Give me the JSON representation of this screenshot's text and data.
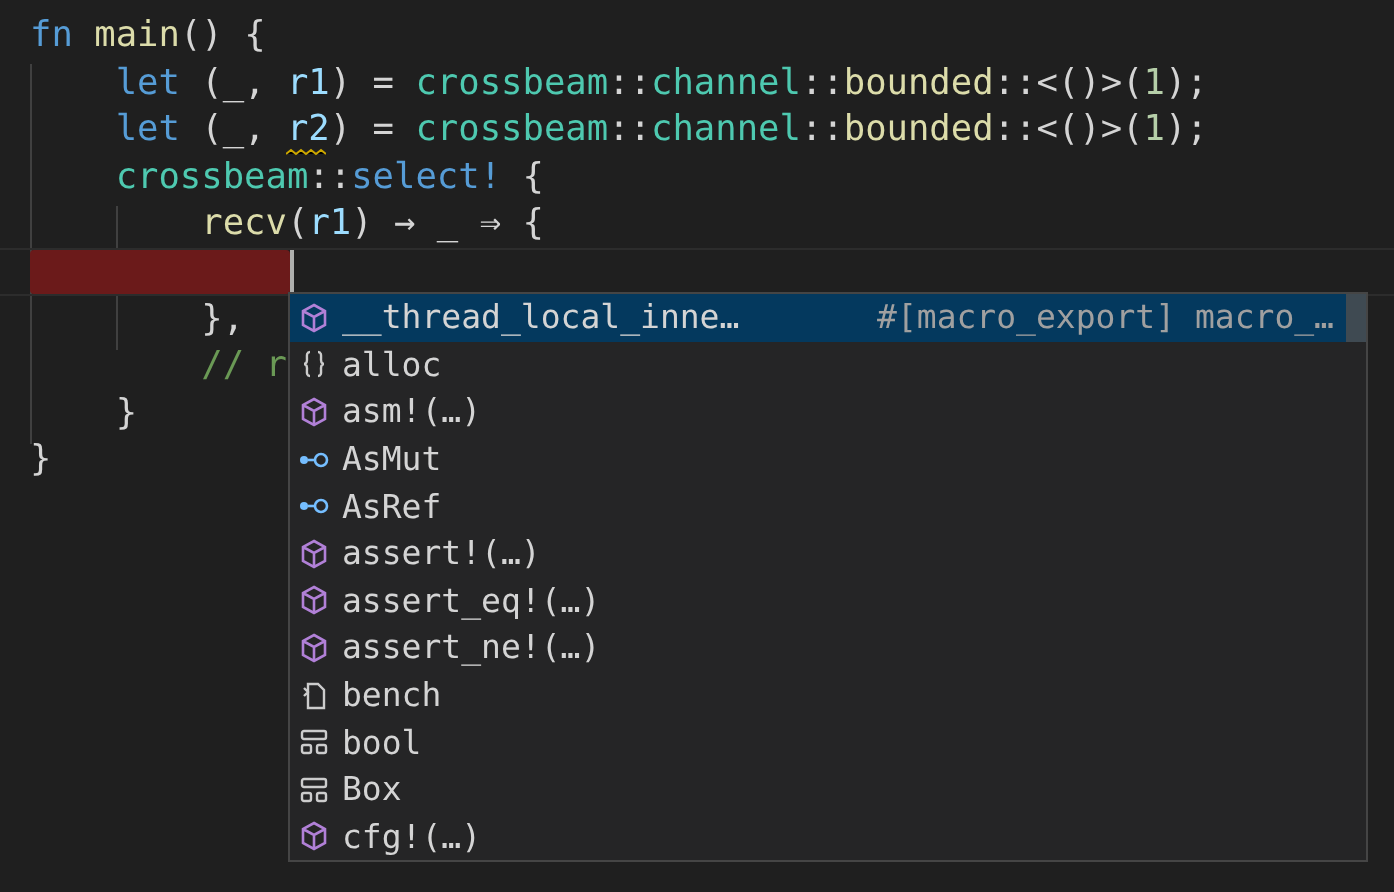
{
  "editor": {
    "lines": [
      {
        "tokens": [
          {
            "text": "fn ",
            "kind": "keyword"
          },
          {
            "text": "main",
            "kind": "function"
          },
          {
            "text": "() {",
            "kind": "plain"
          }
        ]
      },
      {
        "tokens": [
          {
            "text": "    let",
            "kind": "keyword"
          },
          {
            "text": " (_, ",
            "kind": "plain"
          },
          {
            "text": "r1",
            "kind": "variable"
          },
          {
            "text": ") = ",
            "kind": "plain"
          },
          {
            "text": "crossbeam",
            "kind": "namespace"
          },
          {
            "text": "::",
            "kind": "plain"
          },
          {
            "text": "channel",
            "kind": "namespace"
          },
          {
            "text": "::",
            "kind": "plain"
          },
          {
            "text": "bounded",
            "kind": "function"
          },
          {
            "text": "::<()>(",
            "kind": "plain"
          },
          {
            "text": "1",
            "kind": "number"
          },
          {
            "text": ");",
            "kind": "plain"
          }
        ]
      },
      {
        "tokens": [
          {
            "text": "    let",
            "kind": "keyword"
          },
          {
            "text": " (_, ",
            "kind": "plain"
          },
          {
            "text": "r2",
            "kind": "variable",
            "warning": true
          },
          {
            "text": ") = ",
            "kind": "plain"
          },
          {
            "text": "crossbeam",
            "kind": "namespace"
          },
          {
            "text": "::",
            "kind": "plain"
          },
          {
            "text": "channel",
            "kind": "namespace"
          },
          {
            "text": "::",
            "kind": "plain"
          },
          {
            "text": "bounded",
            "kind": "function"
          },
          {
            "text": "::<()>(",
            "kind": "plain"
          },
          {
            "text": "1",
            "kind": "number"
          },
          {
            "text": ");",
            "kind": "plain"
          }
        ]
      },
      {
        "tokens": [
          {
            "text": "    crossbeam",
            "kind": "namespace"
          },
          {
            "text": "::",
            "kind": "plain"
          },
          {
            "text": "select!",
            "kind": "keyword"
          },
          {
            "text": " {",
            "kind": "plain"
          }
        ]
      },
      {
        "tokens": [
          {
            "text": "        recv",
            "kind": "function"
          },
          {
            "text": "(",
            "kind": "plain"
          },
          {
            "text": "r1",
            "kind": "variable"
          },
          {
            "text": ") → _ ⇒ {",
            "kind": "plain"
          }
        ]
      },
      {
        "current": true,
        "error": true
      },
      {
        "tokens": [
          {
            "text": "        },",
            "kind": "plain"
          }
        ]
      },
      {
        "tokens": [
          {
            "text": "        // r",
            "kind": "comment"
          }
        ]
      },
      {
        "tokens": [
          {
            "text": "    }",
            "kind": "plain"
          }
        ]
      },
      {
        "tokens": [
          {
            "text": "}",
            "kind": "plain"
          }
        ]
      }
    ]
  },
  "suggestions": [
    {
      "label": "__thread_local_inne…",
      "kind": "module",
      "detail": "#[macro_export] macro_…",
      "selected": true
    },
    {
      "label": "alloc",
      "kind": "namespace",
      "selected": false
    },
    {
      "label": "asm!(…)",
      "kind": "module",
      "selected": false
    },
    {
      "label": "AsMut",
      "kind": "interface",
      "selected": false
    },
    {
      "label": "AsRef",
      "kind": "interface",
      "selected": false
    },
    {
      "label": "assert!(…)",
      "kind": "module",
      "selected": false
    },
    {
      "label": "assert_eq!(…)",
      "kind": "module",
      "selected": false
    },
    {
      "label": "assert_ne!(…)",
      "kind": "module",
      "selected": false
    },
    {
      "label": "bench",
      "kind": "snippet",
      "selected": false
    },
    {
      "label": "bool",
      "kind": "struct",
      "selected": false
    },
    {
      "label": "Box",
      "kind": "struct",
      "selected": false
    },
    {
      "label": "cfg!(…)",
      "kind": "module",
      "selected": false
    }
  ]
}
